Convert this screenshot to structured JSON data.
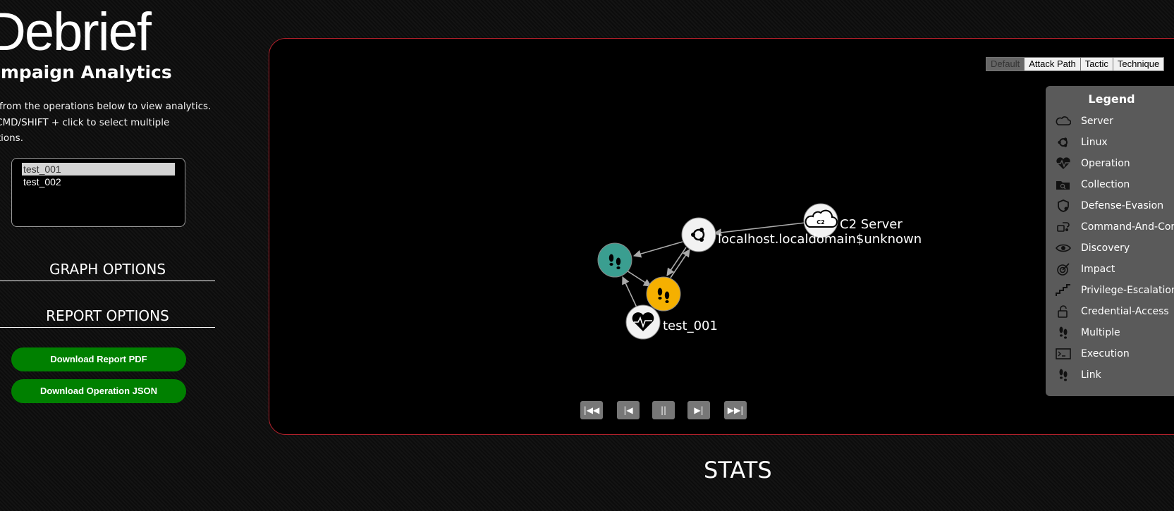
{
  "sidebar": {
    "title": "Debrief",
    "subtitle": "ampaign Analytics",
    "instructions": "ct from the operations below to view analytics. L/CMD/SHIFT + click to select multiple rations.",
    "instruction_lines": [
      "ct from the operations below to view analytics.",
      "L/CMD/SHIFT + click to select multiple",
      "rations."
    ],
    "operations": [
      {
        "label": "test_001",
        "selected": true
      },
      {
        "label": "test_002",
        "selected": false
      }
    ],
    "graph_options_label": "GRAPH OPTIONS",
    "report_options_label": "REPORT OPTIONS",
    "download_pdf_label": "Download Report PDF",
    "download_json_label": "Download Operation JSON"
  },
  "graph": {
    "tabs": [
      {
        "label": "Default",
        "active": true
      },
      {
        "label": "Attack Path",
        "active": false
      },
      {
        "label": "Tactic",
        "active": false
      },
      {
        "label": "Technique",
        "active": false
      }
    ],
    "legend": {
      "title": "Legend",
      "items": [
        {
          "label": "Server",
          "icon": "cloud-icon"
        },
        {
          "label": "Linux",
          "icon": "linux-icon"
        },
        {
          "label": "Operation",
          "icon": "heartbeat-icon"
        },
        {
          "label": "Collection",
          "icon": "folder-search-icon"
        },
        {
          "label": "Defense-Evasion",
          "icon": "shield-icon"
        },
        {
          "label": "Command-And-Cont",
          "icon": "command-icon"
        },
        {
          "label": "Discovery",
          "icon": "eye-icon"
        },
        {
          "label": "Impact",
          "icon": "target-icon"
        },
        {
          "label": "Privilege-Escalation",
          "icon": "stairs-icon"
        },
        {
          "label": "Credential-Access",
          "icon": "unlock-icon"
        },
        {
          "label": "Multiple",
          "icon": "footprints-icon"
        },
        {
          "label": "Execution",
          "icon": "terminal-icon"
        },
        {
          "label": "Link",
          "icon": "footprints-icon"
        }
      ]
    },
    "nodes": {
      "c2_label": "C2 Server",
      "c2_badge": "C2",
      "host_label": "localhost.localdomain$unknown",
      "operation_label": "test_001"
    },
    "colors": {
      "link_teal": "#3a9e90",
      "link_orange": "#f5b000",
      "node_white": "#f2f2f2",
      "panel_border": "#b0202a",
      "button_green": "#008000"
    },
    "controls": [
      "|◀◀",
      "|◀",
      "||",
      "▶|",
      "▶▶|"
    ]
  },
  "stats_heading": "STATS"
}
